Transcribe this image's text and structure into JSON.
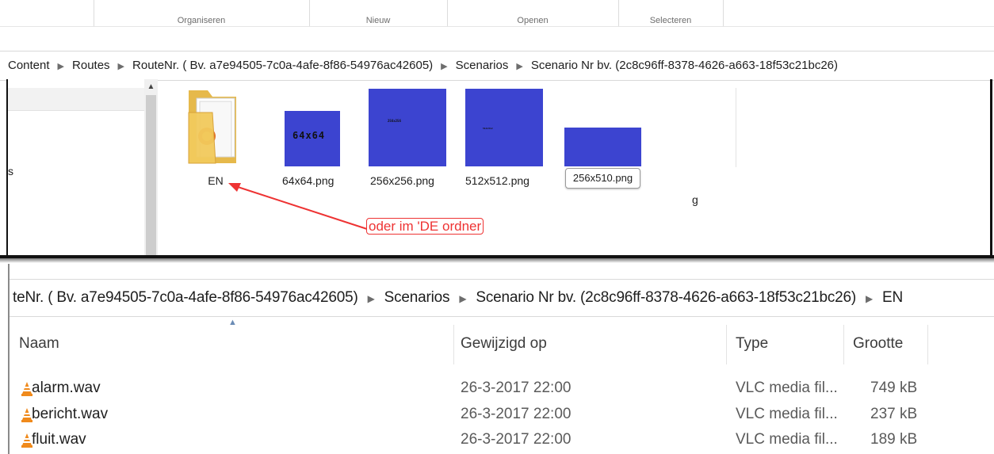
{
  "top_window": {
    "ribbon": [
      "Organiseren",
      "Nieuw",
      "Openen",
      "Selecteren"
    ],
    "breadcrumb": [
      "Content",
      "Routes",
      "RouteNr. ( Bv. a7e94505-7c0a-4afe-8f86-54976ac42605)",
      "Scenarios",
      "Scenario Nr  bv. (2c8c96ff-8378-4626-a663-18f53c21bc26)"
    ],
    "nav_item_partial": "s",
    "files": [
      {
        "label": "EN",
        "kind": "folder"
      },
      {
        "label": "64x64.png",
        "thumb_text": "64x64"
      },
      {
        "label": "256x256.png",
        "thumb_text": "256x256"
      },
      {
        "label": "512x512.png",
        "thumb_text": "512x512"
      },
      {
        "label": "256x510.png"
      }
    ],
    "stray_char": "g",
    "annotation": "oder im 'DE ordner",
    "thumb_color": "#3c44d0",
    "annotation_color": "#ee3333"
  },
  "bottom_window": {
    "breadcrumb": [
      "teNr. ( Bv. a7e94505-7c0a-4afe-8f86-54976ac42605)",
      "Scenarios",
      "Scenario Nr  bv. (2c8c96ff-8378-4626-a663-18f53c21bc26)",
      "EN"
    ],
    "columns": {
      "name": "Naam",
      "modified": "Gewijzigd op",
      "type": "Type",
      "size": "Grootte"
    },
    "rows": [
      {
        "name": "alarm.wav",
        "modified": "26-3-2017 22:00",
        "type": "VLC media fil...",
        "size": "749 kB"
      },
      {
        "name": "bericht.wav",
        "modified": "26-3-2017 22:00",
        "type": "VLC media fil...",
        "size": "237 kB"
      },
      {
        "name": "fluit.wav",
        "modified": "26-3-2017 22:00",
        "type": "VLC media fil...",
        "size": "189 kB"
      }
    ]
  }
}
